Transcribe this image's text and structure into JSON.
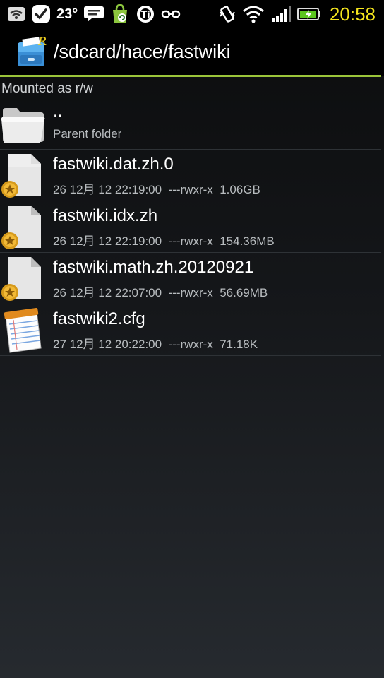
{
  "status_bar": {
    "temperature": "23°",
    "time": "20:58"
  },
  "title_bar": {
    "path": "/sdcard/hace/fastwiki"
  },
  "mount_status": "Mounted as r/w",
  "files": [
    {
      "name": "..",
      "meta": "Parent folder",
      "icon": "folder-icon"
    },
    {
      "name": "fastwiki.dat.zh.0",
      "date": "26 12月 12 22:19:00",
      "permissions": "---rwxr-x",
      "size": "1.06GB",
      "meta": "26 12月 12 22:19:00  ---rwxr-x  1.06GB",
      "icon": "locked-file-icon"
    },
    {
      "name": "fastwiki.idx.zh",
      "date": "26 12月 12 22:19:00",
      "permissions": "---rwxr-x",
      "size": "154.36MB",
      "meta": "26 12月 12 22:19:00  ---rwxr-x  154.36MB",
      "icon": "locked-file-icon"
    },
    {
      "name": "fastwiki.math.zh.20120921",
      "date": "26 12月 12 22:07:00",
      "permissions": "---rwxr-x",
      "size": "56.69MB",
      "meta": "26 12月 12 22:07:00  ---rwxr-x  56.69MB",
      "icon": "locked-file-icon"
    },
    {
      "name": "fastwiki2.cfg",
      "date": "27 12月 12 20:22:00",
      "permissions": "---rwxr-x",
      "size": "71.18K",
      "meta": "27 12月 12 20:22:00  ---rwxr-x  71.18K",
      "icon": "text-file-icon"
    }
  ],
  "colors": {
    "accent": "#9bc43a",
    "clock": "#f5e61e"
  }
}
